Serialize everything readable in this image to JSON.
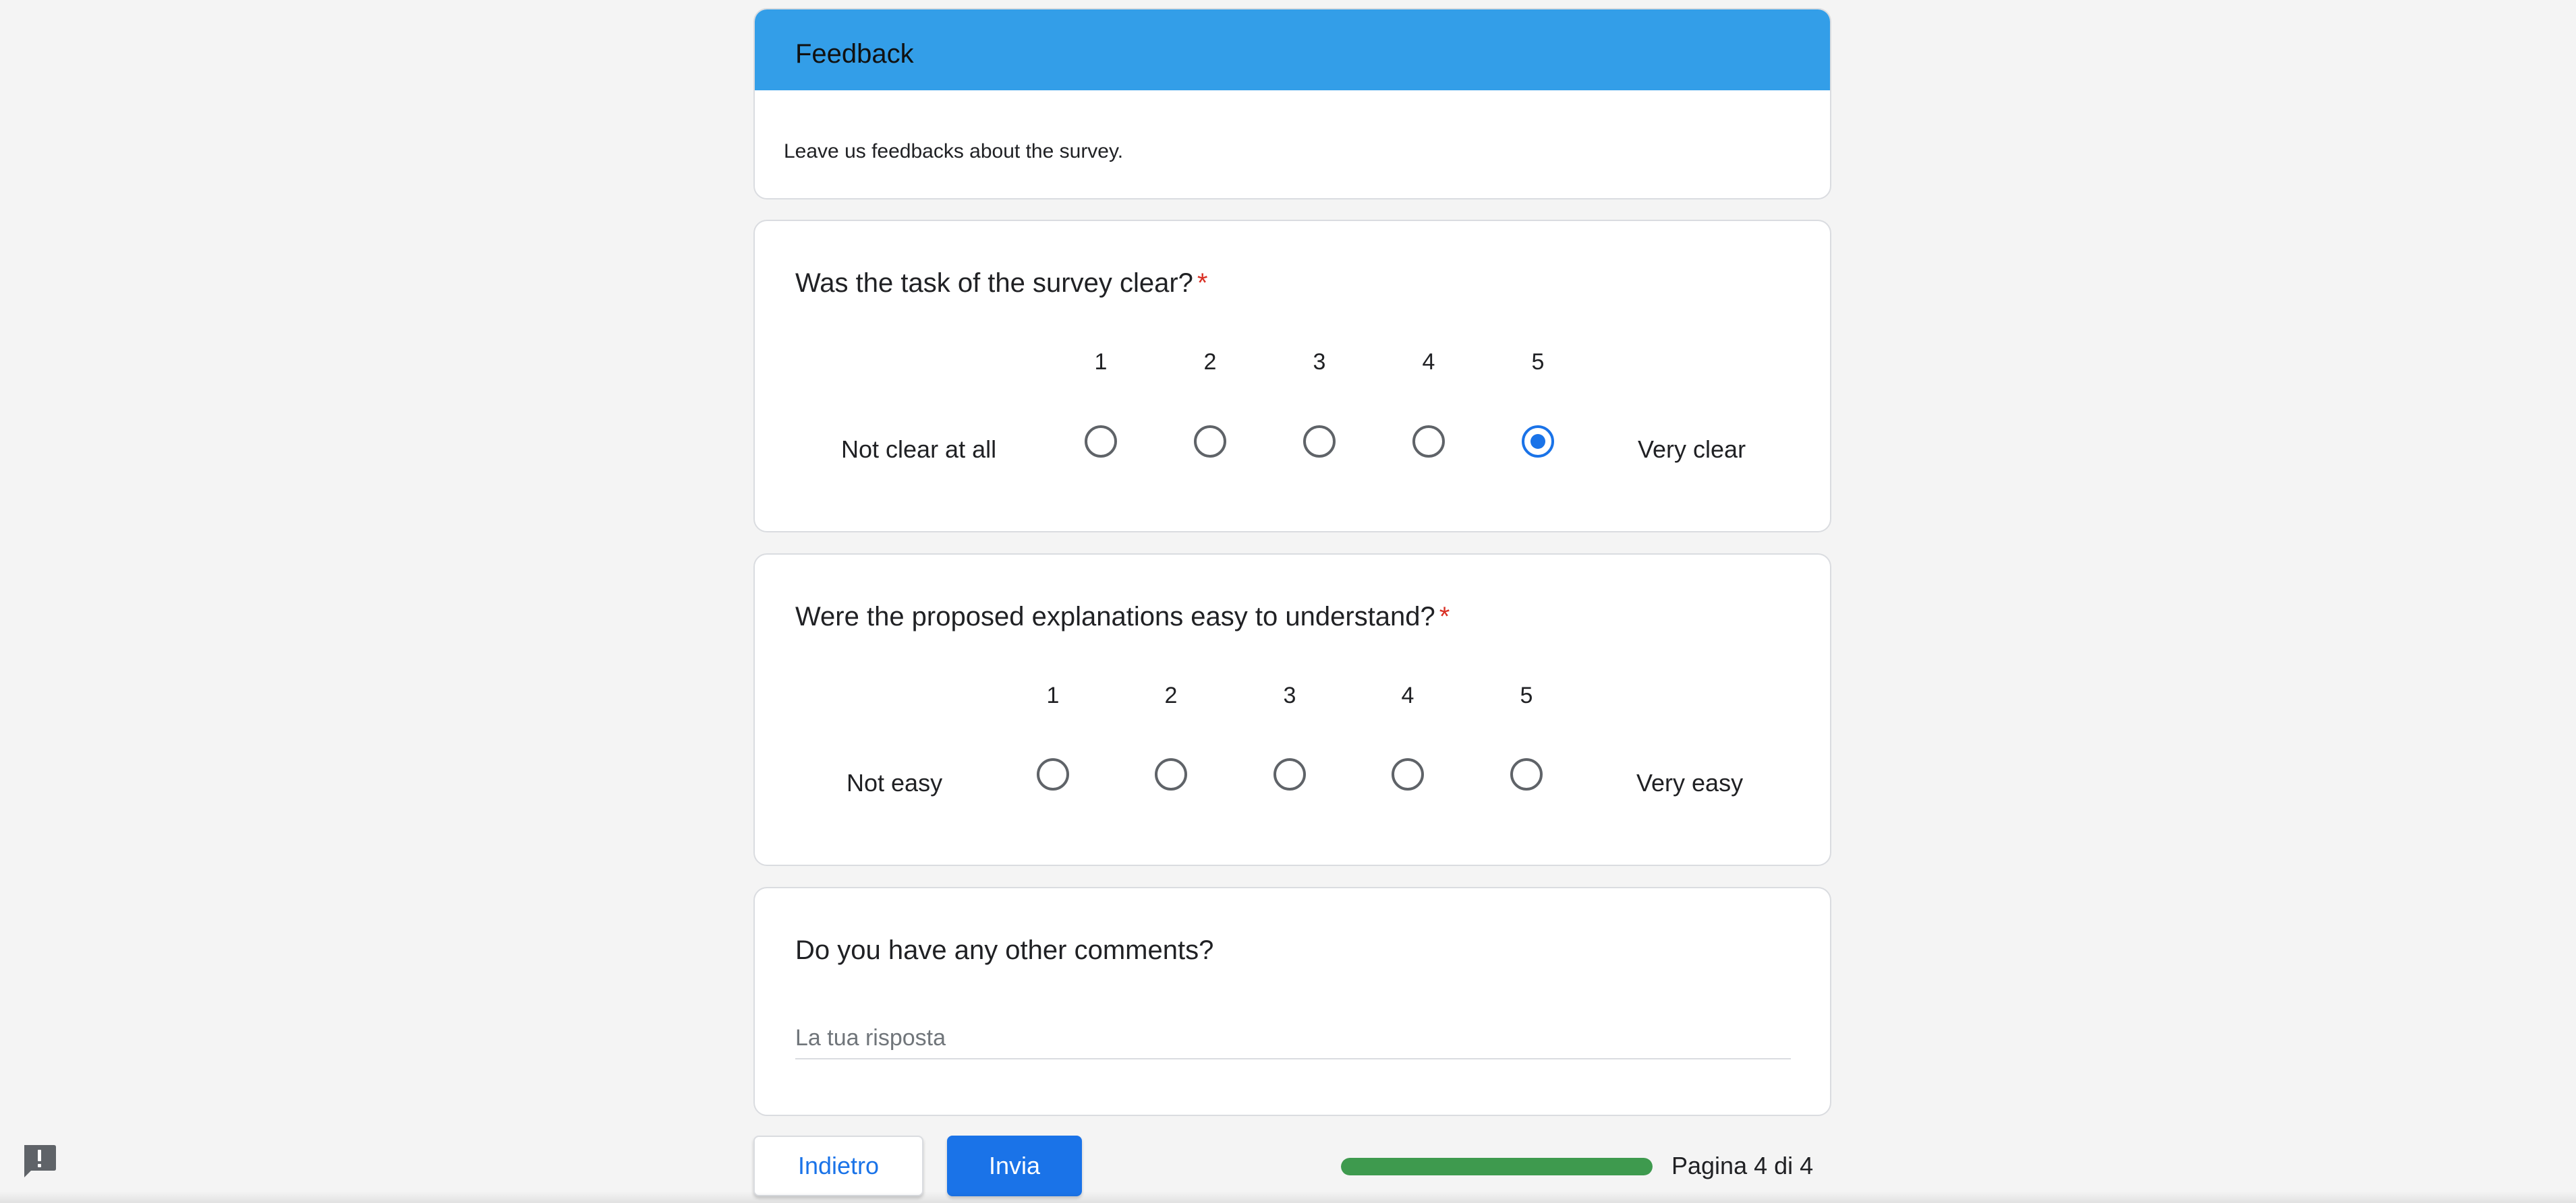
{
  "header": {
    "title": "Feedback",
    "description": "Leave us feedbacks about the survey."
  },
  "questions": [
    {
      "title": "Was the task of the survey clear?",
      "required_mark": "*",
      "scale": [
        "1",
        "2",
        "3",
        "4",
        "5"
      ],
      "min_label": "Not clear at all",
      "max_label": "Very clear",
      "selected": "5"
    },
    {
      "title": "Were the proposed explanations easy to understand?",
      "required_mark": "*",
      "scale": [
        "1",
        "2",
        "3",
        "4",
        "5"
      ],
      "min_label": "Not easy",
      "max_label": "Very easy",
      "selected": null
    },
    {
      "title": "Do you have any other comments?",
      "input_placeholder": "La tua risposta",
      "input_value": ""
    }
  ],
  "footer": {
    "back_label": "Indietro",
    "submit_label": "Invia",
    "progress_fraction": 1.0,
    "page_label": "Pagina 4 di 4"
  },
  "colors": {
    "header": "#339ee8",
    "accent": "#1a73e8",
    "required": "#d93025",
    "progress": "#3e9a4e"
  },
  "icons": {
    "report": "report-problem-icon"
  }
}
